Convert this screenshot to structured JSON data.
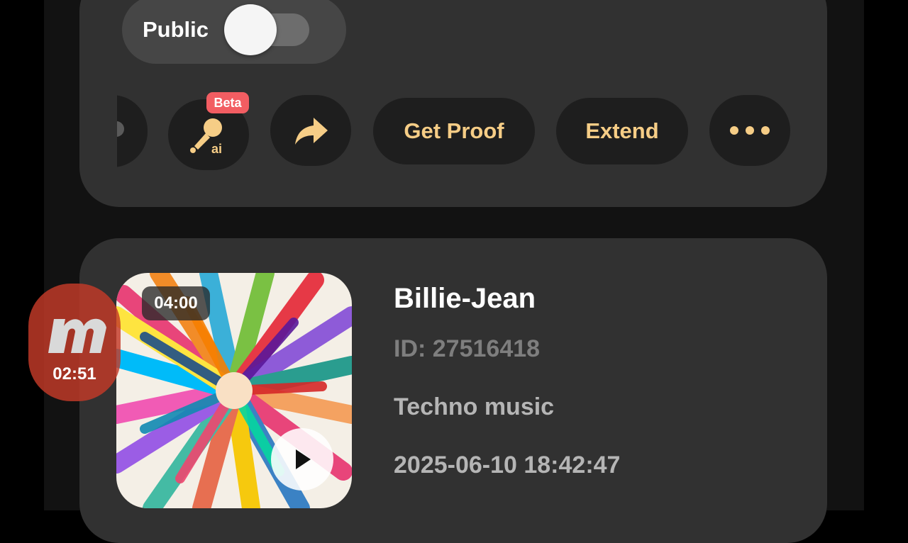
{
  "visibility": {
    "label": "Public",
    "is_public": true
  },
  "actions": {
    "partial_icon": "partial-circle-icon",
    "ai_voice_icon": "ai-microphone-icon",
    "ai_voice_badge": "Beta",
    "share_icon": "share-arrow-icon",
    "get_proof_label": "Get Proof",
    "extend_label": "Extend",
    "more_icon": "more-dots-icon"
  },
  "song": {
    "title": "Billie-Jean",
    "id": "ID: 27516418",
    "genre": "Techno music",
    "created": "2025-06-10 18:42:47",
    "duration": "04:00",
    "cover_icon": "hands-art-cover",
    "play_icon": "play-icon"
  },
  "overlay": {
    "time": "02:51",
    "logo_icon": "m-logo-icon"
  },
  "colors": {
    "background": "#121212",
    "card": "#313131",
    "action_bg": "#1e1e1e",
    "accent": "#f6cd86",
    "badge": "#f25d62",
    "muted_text": "#7e7e7e",
    "secondary_text": "#b5b5b5"
  }
}
